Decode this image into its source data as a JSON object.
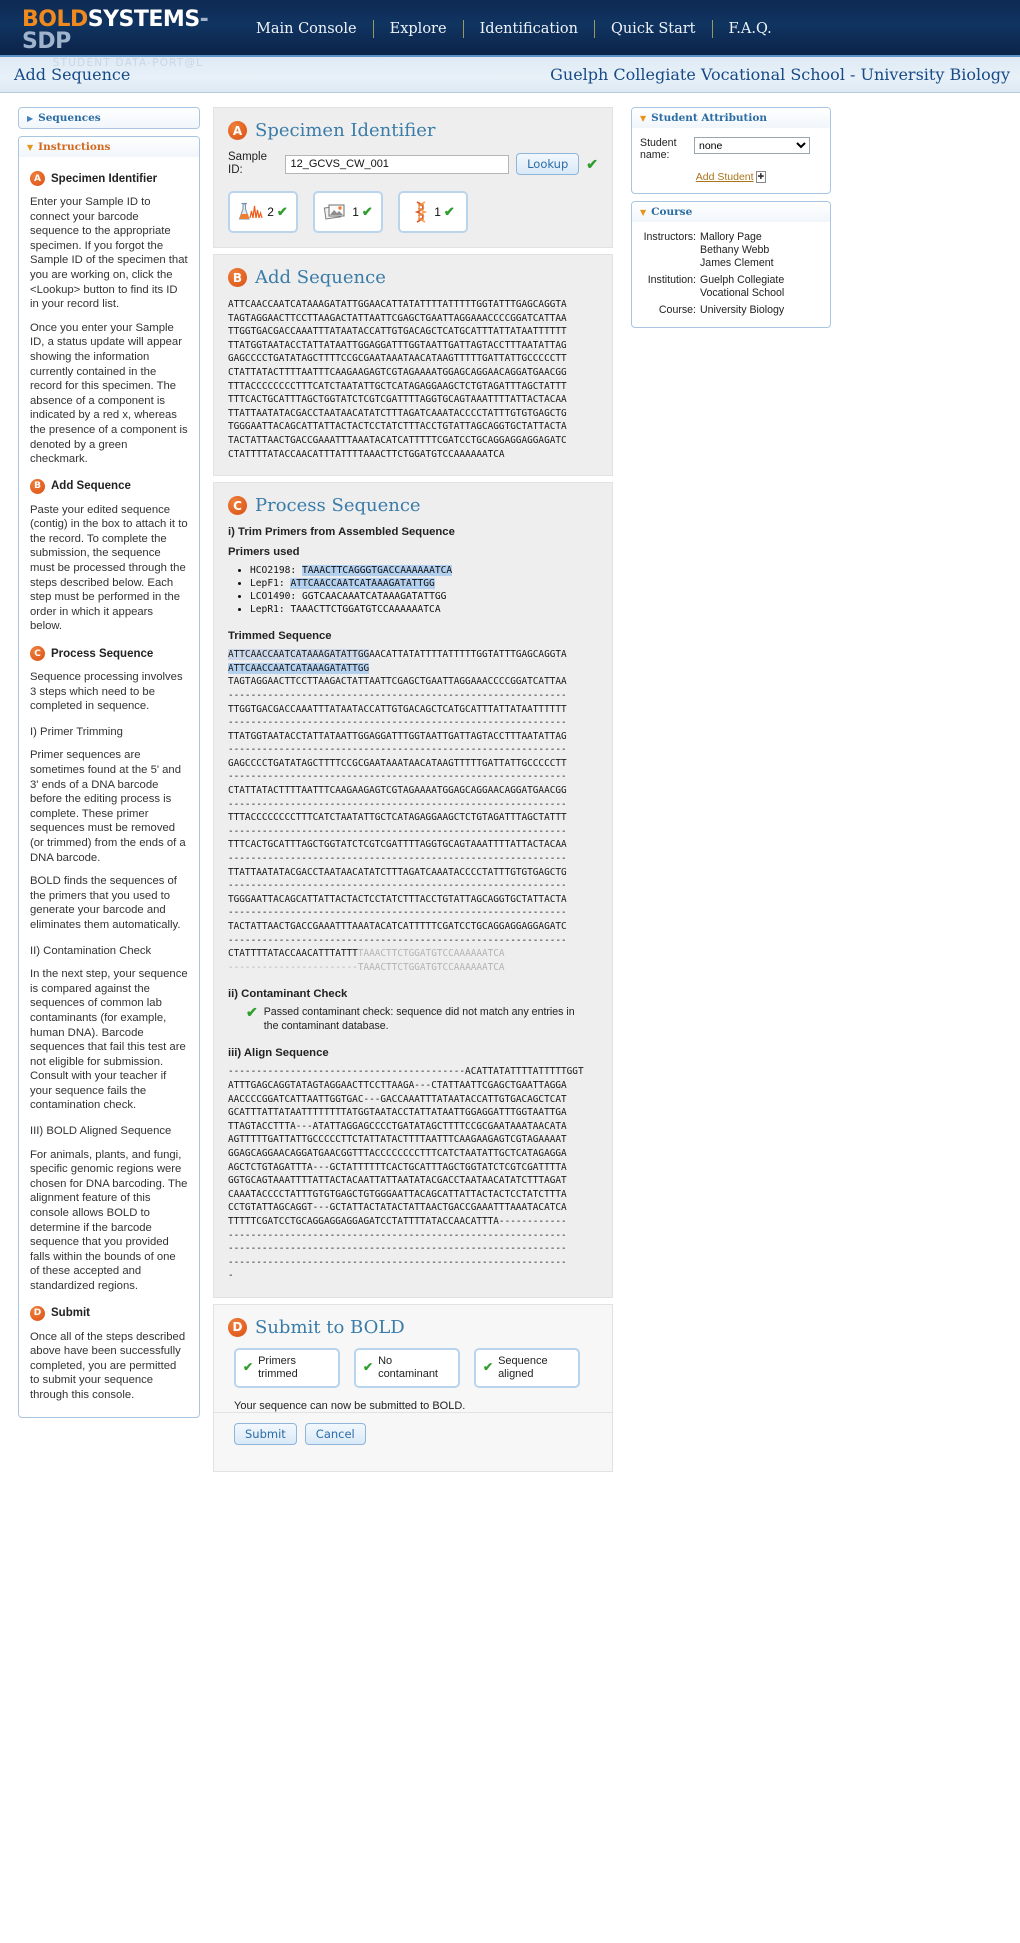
{
  "header": {
    "logo": {
      "bold": "BOLD",
      "systems": "SYSTEMS",
      "sdp": "-SDP",
      "tagline": "STUDENT  DATA-PORT@L"
    },
    "nav": [
      "Main Console",
      "Explore",
      "Identification",
      "Quick Start",
      "F.A.Q."
    ],
    "page_title": "Add Sequence",
    "context_title": "Guelph Collegiate Vocational School - University Biology"
  },
  "sidebar": {
    "sequences_label": "Sequences",
    "instructions_label": "Instructions",
    "sections": [
      {
        "badge": "A",
        "title": "Specimen Identifier",
        "paragraphs": [
          "Enter your Sample ID to connect your barcode sequence to the appropriate specimen. If you forgot the Sample ID of the specimen that you are working on, click the <Lookup> button to find its ID in your record list.",
          "Once you enter your Sample ID, a status update will appear showing the information currently contained in the record for this specimen. The absence of a component is indicated by a red x, whereas the presence of a component is denoted by a green checkmark."
        ]
      },
      {
        "badge": "B",
        "title": "Add Sequence",
        "paragraphs": [
          "Paste your edited sequence (contig) in the box to attach it to the record. To complete the submission, the sequence must be processed through the steps described below. Each step must be performed in the order in which it appears below."
        ]
      },
      {
        "badge": "C",
        "title": "Process Sequence",
        "paragraphs": [
          "Sequence processing involves 3 steps which need to be completed in sequence."
        ],
        "subsections": [
          {
            "heading": "I) Primer Trimming",
            "paragraphs": [
              "Primer sequences are sometimes found at the 5' and 3' ends of a DNA barcode before the editing process is complete. These primer sequences must be removed (or trimmed) from the ends of a DNA barcode.",
              "BOLD finds the sequences of the primers that you used to generate your barcode and eliminates them automatically."
            ]
          },
          {
            "heading": "II) Contamination Check",
            "paragraphs": [
              "In the next step, your sequence is compared against the sequences of common lab contaminants (for example, human DNA). Barcode sequences that fail this test are not eligible for submission. Consult with your teacher if your sequence fails the contamination check."
            ]
          },
          {
            "heading": "III) BOLD Aligned Sequence",
            "paragraphs": [
              "For animals, plants, and fungi, specific genomic regions were chosen for DNA barcoding. The alignment feature of this console allows BOLD to determine if the barcode sequence that you provided falls within the bounds of one of these accepted and standardized regions."
            ]
          }
        ]
      },
      {
        "badge": "D",
        "title": "Submit",
        "paragraphs": [
          "Once all of the steps described above have been successfully completed, you are permitted to submit your sequence through this console."
        ]
      }
    ]
  },
  "specimen": {
    "badge": "A",
    "title": "Specimen Identifier",
    "sample_id_label": "Sample ID:",
    "sample_id_value": "12_GCVS_CW_001",
    "lookup_label": "Lookup",
    "status_check": "✔",
    "components": [
      {
        "icon": "trace-chromatogram-icon",
        "count": "2",
        "check": "✔"
      },
      {
        "icon": "images-icon",
        "count": "1",
        "check": "✔"
      },
      {
        "icon": "dna-helix-icon",
        "count": "1",
        "check": "✔"
      }
    ]
  },
  "add_sequence": {
    "badge": "B",
    "title": "Add Sequence",
    "sequence": "ATTCAACCAATCATAAAGATATTGGAACATTATATTTTATTTTTGGTATTTGAGCAGGTA\nTAGTAGGAACTTCCTTAAGACTATTAATTCGAGCTGAATTAGGAAACCCCGGATCATTAA\nTTGGTGACGACCAAATTTATAATACCATTGTGACAGCTCATGCATTTATTATAATTTTTT\nTTATGGTAATACCTATTATAATTGGAGGATTTGGTAATTGATTAGTACCTTTAATATTAG\nGAGCCCCTGATATAGCTTTTCCGCGAATAAATAACATAAGTTTTTGATTATTGCCCCCTT\nCTATTATACTTTTAATTTCAAGAAGAGTCGTAGAAAATGGAGCAGGAACAGGATGAACGG\nTTTACCCCCCCCTTTCATCTAATATTGCTCATAGAGGAAGCTCTGTAGATTTAGCTATTT\nTTTCACTGCATTTAGCTGGTATCTCGTCGATTTTAGGTGCAGTAAATTTTATTACTACAA\nTTATTAATATACGACCTAATAACATATCTTTAGATCAAATACCCCTATTTGTGTGAGCTG\nTGGGAATTACAGCATTATTACTACTCCTATCTTTACCTGTATTAGCAGGTGCTATTACTA\nTACTATTAACTGACCGAAATTTAAATACATCATTTTTCGATCCTGCAGGAGGAGGAGATC\nCTATTTTATACCAACATTTATTTTAAACTTCTGGATGTCCAAAAAATCA"
  },
  "process": {
    "badge": "C",
    "title": "Process Sequence",
    "step1_heading": "i) Trim Primers from Assembled Sequence",
    "primers_used_label": "Primers used",
    "primers": [
      {
        "name": "HCO2198:",
        "seq": "TAAACTTCAGGGTGACCAAAAAATCA",
        "highlight": true
      },
      {
        "name": "LepF1:",
        "seq": "ATTCAACCAATCATAAAGATATTGG",
        "highlight": true
      },
      {
        "name": "LCO1490:",
        "seq": "GGTCAACAAATCATAAAGATATTGG",
        "highlight": false
      },
      {
        "name": "LepR1:",
        "seq": "TAAACTTCTGGATGTCCAAAAAATCA",
        "highlight": false
      }
    ],
    "trimmed_heading": "Trimmed Sequence",
    "trimmed_head_primer": "ATTCAACCAATCATAAAGATATTGG",
    "trimmed_head_rest": "AACATTATATTTTATTTTTGGTATTTGAGCAGGTA",
    "trimmed_head_line2": "ATTCAACCAATCATAAAGATATTGG",
    "trimmed_body": "TAGTAGGAACTTCCTTAAGACTATTAATTCGAGCTGAATTAGGAAACCCCGGATCATTAA\n------------------------------------------------------------\nTTGGTGACGACCAAATTTATAATACCATTGTGACAGCTCATGCATTTATTATAATTTTTT\n------------------------------------------------------------\nTTATGGTAATACCTATTATAATTGGAGGATTTGGTAATTGATTAGTACCTTTAATATTAG\n------------------------------------------------------------\nGAGCCCCTGATATAGCTTTTCCGCGAATAAATAACATAAGTTTTTGATTATTGCCCCCTT\n------------------------------------------------------------\nCTATTATACTTTTAATTTCAAGAAGAGTCGTAGAAAATGGAGCAGGAACAGGATGAACGG\n------------------------------------------------------------\nTTTACCCCCCCCTTTCATCTAATATTGCTCATAGAGGAAGCTCTGTAGATTTAGCTATTT\n------------------------------------------------------------\nTTTCACTGCATTTAGCTGGTATCTCGTCGATTTTAGGTGCAGTAAATTTTATTACTACAA\n------------------------------------------------------------\nTTATTAATATACGACCTAATAACATATCTTTAGATCAAATACCCCTATTTGTGTGAGCTG\n------------------------------------------------------------\nTGGGAATTACAGCATTATTACTACTCCTATCTTTACCTGTATTAGCAGGTGCTATTACTA\n------------------------------------------------------------\nTACTATTAACTGACCGAAATTTAAATACATCATTTTTCGATCCTGCAGGAGGAGGAGATC\n------------------------------------------------------------",
    "trimmed_tail_kept": "CTATTTTATACCAACATTTATTT",
    "trimmed_tail_primer": "TAAACTTCTGGATGTCCAAAAAATCA",
    "trimmed_tail_line2_dashes": "-----------------------",
    "trimmed_tail_line2_primer": "TAAACTTCTGGATGTCCAAAAAATCA",
    "step2_heading": "ii) Contaminant Check",
    "contaminant_check": "✔",
    "contaminant_result": "Passed contaminant check: sequence did not match any entries in the contaminant database.",
    "step3_heading": "iii) Align Sequence",
    "aligned": "------------------------------------------ACATTATATTTTATTTTTGGT\nATTTGAGCAGGTATAGTAGGAACTTCCTTAAGA---CTATTAATTCGAGCTGAATTAGGA\nAACCCCGGATCATTAATTGGTGAC---GACCAAATTTATAATACCATTGTGACAGCTCAT\nGCATTTATTATAATTTTTTTTATGGTAATACCTATTATAATTGGAGGATTTGGTAATTGA\nTTAGTACCTTTA---ATATTAGGAGCCCCTGATATAGCTTTTCCGCGAATAAATAACATA\nAGTTTTTGATTATTGCCCCCTTCTATTATACTTTTAATTTCAAGAAGAGTCGTAGAAAAT\nGGAGCAGGAACAGGATGAACGGTTTACCCCCCCCTTTCATCTAATATTGCTCATAGAGGA\nAGCTCTGTAGATTTA---GCTATTTTTTCACTGCATTTAGCTGGTATCTCGTCGATTTTA\nGGTGCAGTAAATTTTATTACTACAATTATTAATATACGACCTAATAACATATCTTTAGAT\nCAAATACCCCTATTTGTGTGAGCTGTGGGAATTACAGCATTATTACTACTCCTATCTTTA\nCCTGTATTAGCAGGT---GCTATTACTATACTATTAACTGACCGAAATTTAAATACATCA\nTTTTTCGATCCTGCAGGAGGAGGAGATCCTATTTTATACCAACATTTA------------\n------------------------------------------------------------\n------------------------------------------------------------\n------------------------------------------------------------\n-"
  },
  "submit": {
    "badge": "D",
    "title": "Submit to BOLD",
    "boxes": [
      {
        "check": "✔",
        "label": "Primers trimmed"
      },
      {
        "check": "✔",
        "label": "No contaminant"
      },
      {
        "check": "✔",
        "label": "Sequence aligned"
      }
    ],
    "note": "Your sequence can now be submitted to BOLD.",
    "submit_label": "Submit",
    "cancel_label": "Cancel"
  },
  "student_attribution": {
    "panel_title": "Student Attribution",
    "student_name_label": "Student name:",
    "selected_student": "none",
    "options": [
      "none"
    ],
    "add_student_label": "Add Student"
  },
  "course": {
    "panel_title": "Course",
    "instructors_label": "Instructors:",
    "instructors": [
      "Mallory Page",
      "Bethany Webb",
      "James Clement"
    ],
    "institution_label": "Institution:",
    "institution": "Guelph Collegiate Vocational School",
    "course_label": "Course:",
    "course_name": "University Biology"
  }
}
